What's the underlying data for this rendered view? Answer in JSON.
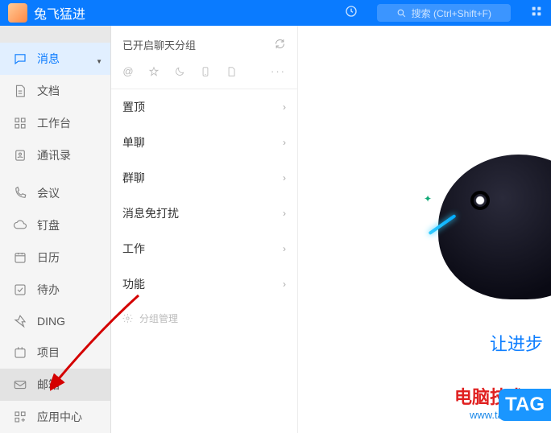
{
  "title": {
    "username": "兔飞猛进",
    "search_placeholder": "搜索 (Ctrl+Shift+F)"
  },
  "sidebar": {
    "items": [
      {
        "label": "消息",
        "icon": "chat"
      },
      {
        "label": "文档",
        "icon": "doc"
      },
      {
        "label": "工作台",
        "icon": "grid"
      },
      {
        "label": "通讯录",
        "icon": "contact"
      },
      {
        "label": "会议",
        "icon": "phone"
      },
      {
        "label": "钉盘",
        "icon": "cloud"
      },
      {
        "label": "日历",
        "icon": "calendar"
      },
      {
        "label": "待办",
        "icon": "todo"
      },
      {
        "label": "DING",
        "icon": "ding"
      },
      {
        "label": "项目",
        "icon": "project"
      },
      {
        "label": "邮箱",
        "icon": "mail"
      },
      {
        "label": "应用中心",
        "icon": "apps"
      }
    ]
  },
  "mid_panel": {
    "header": "已开启聊天分组",
    "groups": [
      "置顶",
      "单聊",
      "群聊",
      "消息免打扰",
      "工作",
      "功能"
    ],
    "manage_label": "分组管理"
  },
  "content": {
    "tagline": "让进步",
    "footer_site": "电脑技术网",
    "footer_url": "www.tagxp.com",
    "tag_label": "TAG"
  }
}
